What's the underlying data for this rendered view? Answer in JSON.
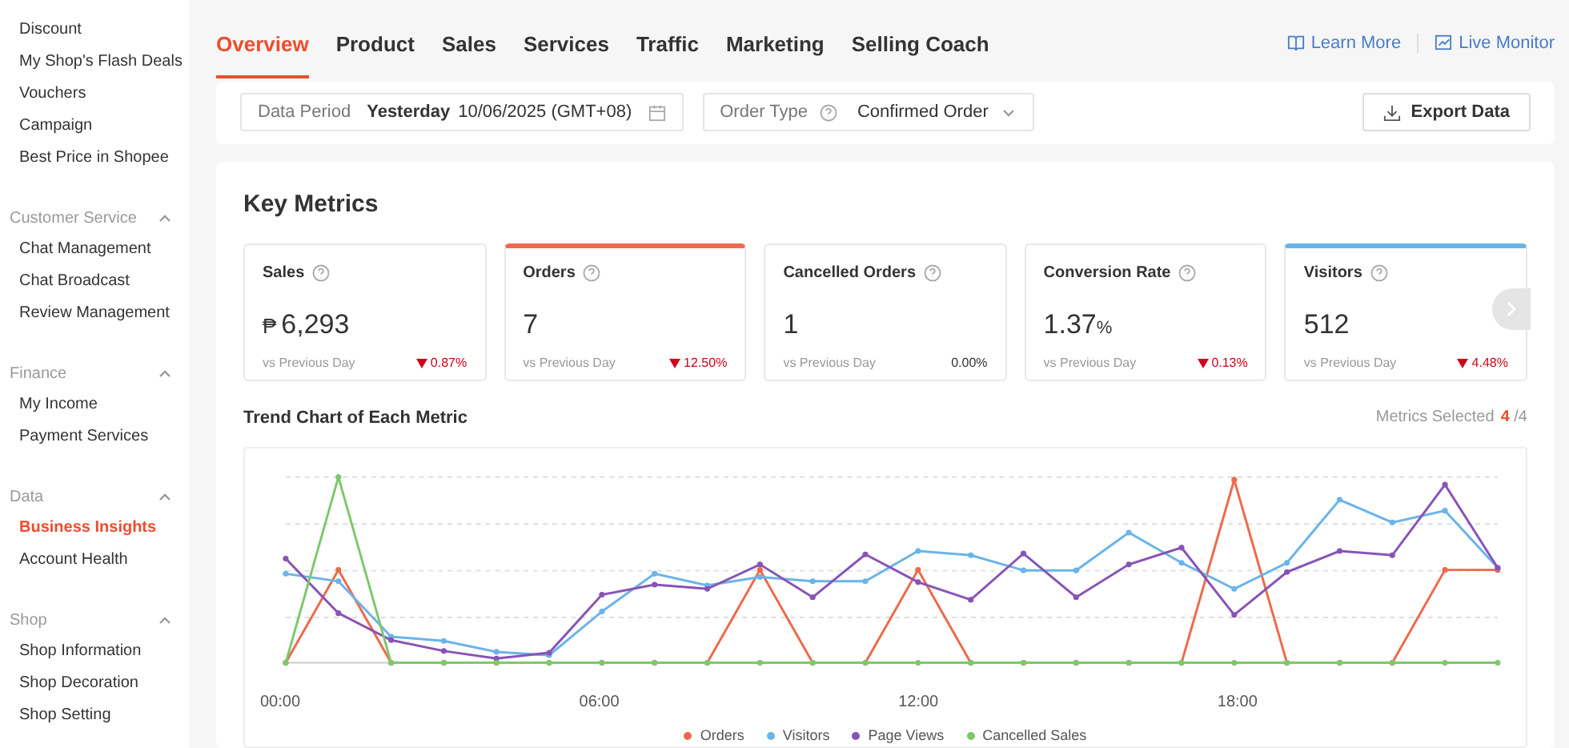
{
  "sidebar": {
    "top_items": [
      {
        "label": "Discount",
        "selected": false
      },
      {
        "label": "My Shop's Flash Deals",
        "selected": false
      },
      {
        "label": "Vouchers",
        "selected": false
      },
      {
        "label": "Campaign",
        "selected": false
      },
      {
        "label": "Best Price in Shopee",
        "selected": false
      }
    ],
    "sections": [
      {
        "title": "Customer Service",
        "expanded": true,
        "items": [
          {
            "label": "Chat Management",
            "selected": false
          },
          {
            "label": "Chat Broadcast",
            "selected": false
          },
          {
            "label": "Review Management",
            "selected": false
          }
        ]
      },
      {
        "title": "Finance",
        "expanded": true,
        "items": [
          {
            "label": "My Income",
            "selected": false
          },
          {
            "label": "Payment Services",
            "selected": false
          }
        ]
      },
      {
        "title": "Data",
        "expanded": true,
        "items": [
          {
            "label": "Business Insights",
            "selected": true
          },
          {
            "label": "Account Health",
            "selected": false
          }
        ]
      },
      {
        "title": "Shop",
        "expanded": true,
        "items": [
          {
            "label": "Shop Information",
            "selected": false
          },
          {
            "label": "Shop Decoration",
            "selected": false
          },
          {
            "label": "Shop Setting",
            "selected": false
          }
        ]
      }
    ]
  },
  "tabs": [
    {
      "label": "Overview",
      "selected": true
    },
    {
      "label": "Product",
      "selected": false
    },
    {
      "label": "Sales",
      "selected": false
    },
    {
      "label": "Services",
      "selected": false
    },
    {
      "label": "Traffic",
      "selected": false
    },
    {
      "label": "Marketing",
      "selected": false
    },
    {
      "label": "Selling Coach",
      "selected": false
    }
  ],
  "header_links": [
    "Learn More",
    "Live Monitor"
  ],
  "filters": {
    "data_period_label": "Data Period",
    "period": "Yesterday",
    "date": "10/06/2025 (GMT+08)",
    "order_type_label": "Order Type",
    "order_type": "Confirmed Order",
    "export_button": "Export Data"
  },
  "key_metrics": {
    "title": "Key Metrics",
    "cards": [
      {
        "label": "Sales",
        "currency": "₱",
        "value": "6,293",
        "compare": "vs Previous Day",
        "change": "0.87%",
        "decreased": true,
        "selected": false
      },
      {
        "label": "Orders",
        "value": "7",
        "compare": "vs Previous Day",
        "change": "12.50%",
        "decreased": true,
        "selected": true,
        "color": "#ee6a4c"
      },
      {
        "label": "Cancelled Orders",
        "value": "1",
        "compare": "vs Previous Day",
        "change": "0.00%",
        "decreased": false,
        "selected": false
      },
      {
        "label": "Conversion Rate",
        "value": "1.37",
        "unit": "%",
        "compare": "vs Previous Day",
        "change": "0.13%",
        "decreased": true,
        "selected": false
      },
      {
        "label": "Visitors",
        "value": "512",
        "compare": "vs Previous Day",
        "change": "4.48%",
        "decreased": true,
        "selected": true,
        "color": "#6ab4ea"
      }
    ]
  },
  "trend_chart": {
    "title": "Trend Chart of Each Metric",
    "metrics_selected_label": "Metrics Selected",
    "selected_count": "4",
    "total_count": "/4",
    "x_labels": [
      "00:00",
      "06:00",
      "12:00",
      "18:00"
    ],
    "legend": [
      {
        "name": "Orders",
        "color": "#ee6a4c"
      },
      {
        "name": "Visitors",
        "color": "#6ab4ea"
      },
      {
        "name": "Page Views",
        "color": "#8853b6"
      },
      {
        "name": "Cancelled Sales",
        "color": "#7cc96a"
      }
    ]
  }
}
